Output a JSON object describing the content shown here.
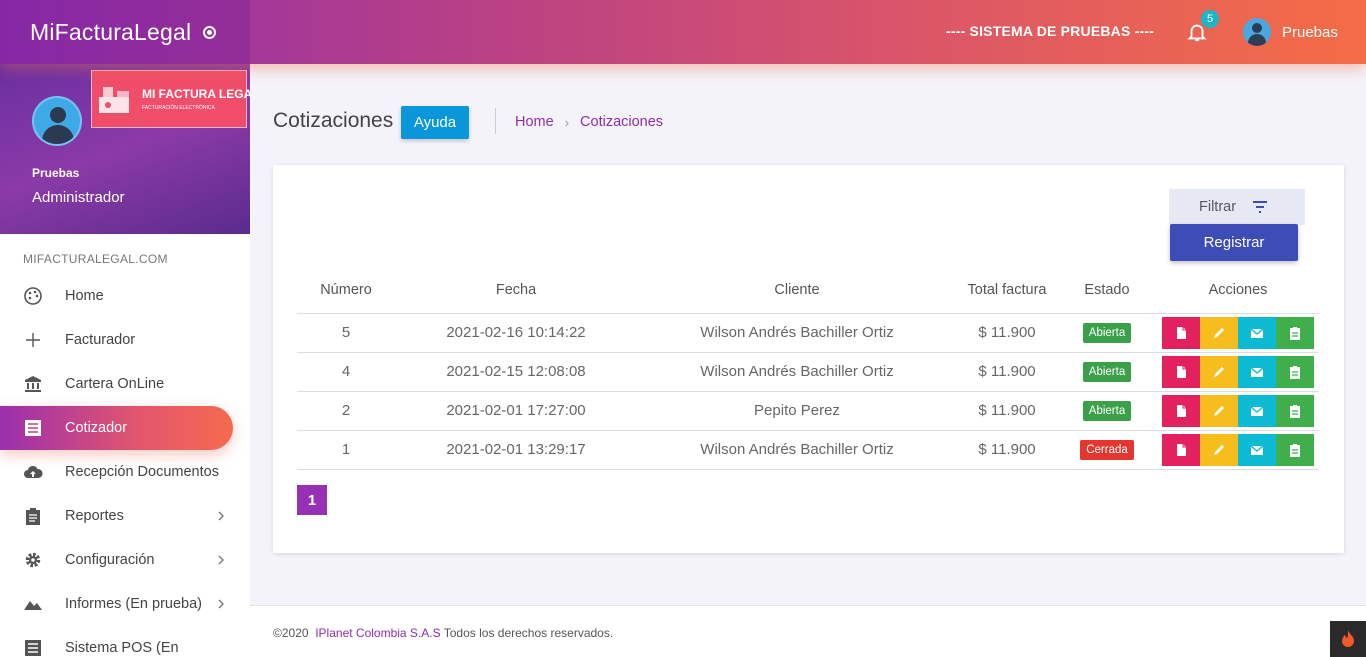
{
  "topbar": {
    "brand": "MiFacturaLegal",
    "environment": "---- SISTEMA DE PRUEBAS ----",
    "notifications_count": "5",
    "user_name": "Pruebas"
  },
  "sidebar": {
    "logo_title": "MI FACTURA LEGAL",
    "logo_subtitle": "FACTURACIÓN ELECTRÓNICA",
    "profile_name": "Pruebas",
    "profile_role": "Administrador",
    "section_title": "MIFACTURALEGAL.COM",
    "items": [
      {
        "label": "Home",
        "icon": "palette-icon"
      },
      {
        "label": "Facturador",
        "icon": "plus-icon"
      },
      {
        "label": "Cartera OnLine",
        "icon": "bank-icon"
      },
      {
        "label": "Cotizador",
        "icon": "list-icon",
        "active": true
      },
      {
        "label": "Recepción Documentos",
        "icon": "cloud-upload-icon"
      },
      {
        "label": "Reportes",
        "icon": "clipboard-icon"
      },
      {
        "label": "Configuración",
        "icon": "gear-icon"
      },
      {
        "label": "Informes (En prueba)",
        "icon": "terrain-icon"
      },
      {
        "label": "Sistema POS (En",
        "icon": "list-icon"
      }
    ]
  },
  "header": {
    "title": "Cotizaciones",
    "help_label": "Ayuda",
    "breadcrumb": [
      "Home",
      "Cotizaciones"
    ]
  },
  "toolbar": {
    "filter_label": "Filtrar",
    "register_label": "Registrar"
  },
  "table": {
    "columns": [
      "Número",
      "Fecha",
      "Cliente",
      "Total factura",
      "Estado",
      "Acciones"
    ],
    "rows": [
      {
        "numero": "5",
        "fecha": "2021-02-16 10:14:22",
        "cliente": "Wilson Andrés Bachiller Ortiz",
        "total": "$ 11.900",
        "estado": "Abierta"
      },
      {
        "numero": "4",
        "fecha": "2021-02-15 12:08:08",
        "cliente": "Wilson Andrés Bachiller Ortiz",
        "total": "$ 11.900",
        "estado": "Abierta"
      },
      {
        "numero": "2",
        "fecha": "2021-02-01 17:27:00",
        "cliente": "Pepito Perez",
        "total": "$ 11.900",
        "estado": "Abierta"
      },
      {
        "numero": "1",
        "fecha": "2021-02-01 13:29:17",
        "cliente": "Wilson Andrés Bachiller Ortiz",
        "total": "$ 11.900",
        "estado": "Cerrada"
      }
    ]
  },
  "pagination": {
    "current": "1"
  },
  "footer": {
    "copyright": "©2020",
    "company": "IPlanet Colombia S.A.S",
    "rights": "Todos los derechos reservados."
  },
  "colors": {
    "accent_purple": "#8e2fb0",
    "accent_orange": "#f46d46",
    "open_status": "#3aa14a",
    "closed_status": "#e4352e",
    "register_button": "#3d4db8",
    "help_button": "#0a96db"
  }
}
